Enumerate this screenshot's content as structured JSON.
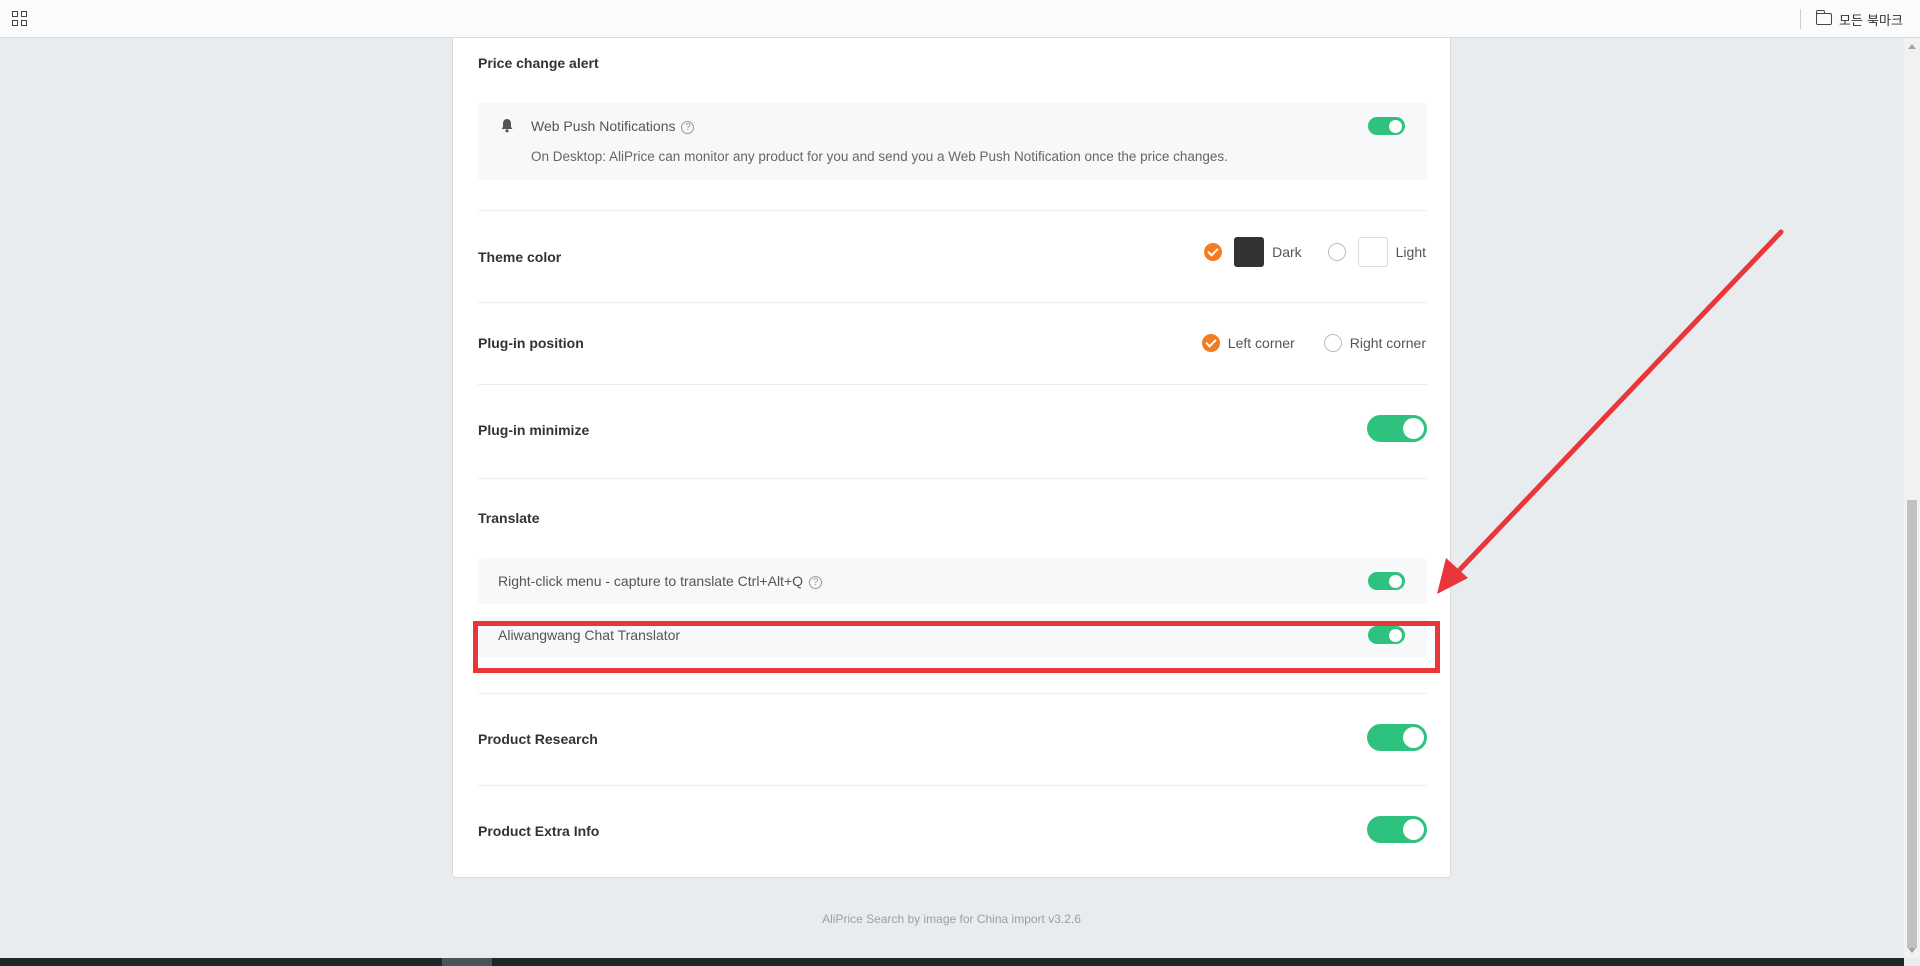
{
  "bookmark_bar": {
    "apps_icon": "apps-grid-icon",
    "folder_icon": "folder-icon",
    "folder_label": "모든 북마크"
  },
  "price_alert": {
    "title": "Price change alert",
    "web_push": {
      "icon": "bell-icon",
      "label": "Web Push Notifications",
      "help": "?",
      "description": "On Desktop: AliPrice can monitor any product for you and send you a Web Push Notification once the price changes.",
      "enabled": true
    }
  },
  "theme": {
    "title": "Theme color",
    "options": [
      {
        "label": "Dark",
        "checked": true,
        "swatch": "#333333"
      },
      {
        "label": "Light",
        "checked": false,
        "swatch": "#ffffff"
      }
    ]
  },
  "plugin_position": {
    "title": "Plug-in position",
    "options": [
      {
        "label": "Left corner",
        "checked": true
      },
      {
        "label": "Right corner",
        "checked": false
      }
    ]
  },
  "plugin_minimize": {
    "title": "Plug-in minimize",
    "enabled": true
  },
  "translate": {
    "title": "Translate",
    "right_click": {
      "label": "Right-click menu - capture to translate Ctrl+Alt+Q",
      "help": "?",
      "enabled": true
    },
    "chat_translator": {
      "label": "Aliwangwang Chat Translator",
      "enabled": true
    }
  },
  "product_research": {
    "title": "Product Research",
    "enabled": true
  },
  "product_extra_info": {
    "title": "Product Extra Info",
    "enabled": true
  },
  "footer": {
    "version_text": "AliPrice Search by image for China import v3.2.6"
  },
  "colors": {
    "toggle_on": "#2ec27e",
    "radio_checked": "#f47b20",
    "annotation_red": "#e8363a"
  }
}
